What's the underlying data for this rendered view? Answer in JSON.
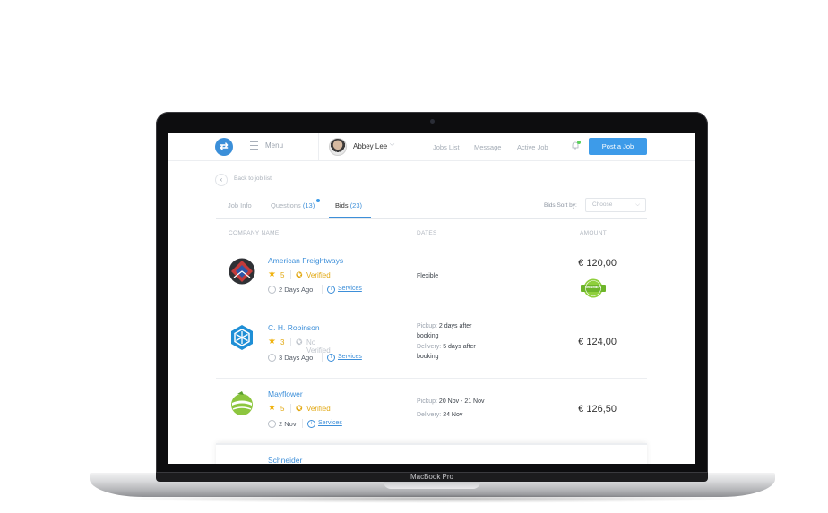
{
  "device": {
    "label": "MacBook Pro"
  },
  "header": {
    "menu_label": "Menu",
    "user_name": "Abbey Lee",
    "nav": [
      "Jobs List",
      "Message",
      "Active Job"
    ],
    "post_button": "Post a Job",
    "accent": "#3d9be9"
  },
  "subheader": {
    "back_label": "Back to job list"
  },
  "tabs": [
    {
      "label": "Job Info",
      "count": ""
    },
    {
      "label": "Questions",
      "count": "(13)"
    },
    {
      "label": "Bids",
      "count": "(23)",
      "active": true
    }
  ],
  "sort": {
    "label": "Bids Sort by:",
    "placeholder": "Choose"
  },
  "columns": {
    "company": "COMPANY NAME",
    "dates": "DATES",
    "amount": "AMOUNT"
  },
  "bids": [
    {
      "company": "American Freightways",
      "rating": "5",
      "verification": "Verified",
      "ago": "2 Days Ago",
      "services": "Services",
      "dates_flexible": "Flexible",
      "amount": "€ 120,00",
      "winner": "WINNER"
    },
    {
      "company": "C. H. Robinson",
      "rating": "3",
      "verification": "No Verified",
      "ago": "3 Days Ago",
      "services": "Services",
      "pickup_label": "Pickup:",
      "pickup_value": "2 days after booking",
      "delivery_label": "Delivery:",
      "delivery_value": "5 days after booking",
      "amount": "€ 124,00"
    },
    {
      "company": "Mayflower",
      "rating": "5",
      "verification": "Verified",
      "ago": "2 Nov",
      "services": "Services",
      "pickup_label": "Pickup:",
      "pickup_value": "20 Nov - 21 Nov",
      "delivery_label": "Delivery:",
      "delivery_value": "24 Nov",
      "amount": "€ 126,50"
    },
    {
      "company": "Schneider"
    }
  ]
}
